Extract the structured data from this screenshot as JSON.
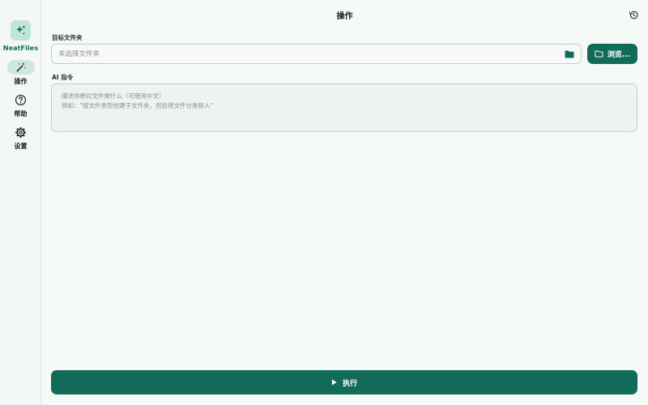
{
  "app": {
    "name": "NeatFiles",
    "logo_icon": "sparkles-icon",
    "accent": "#126a58"
  },
  "sidebar": {
    "items": [
      {
        "label": "操作",
        "icon": "magic-wand-icon",
        "active": true
      },
      {
        "label": "帮助",
        "icon": "help-circle-icon",
        "active": false
      },
      {
        "label": "设置",
        "icon": "gear-icon",
        "active": false
      }
    ]
  },
  "header": {
    "title": "操作",
    "history_icon": "history-icon"
  },
  "target_folder": {
    "label": "目标文件夹",
    "value": "",
    "placeholder": "未选择文件夹",
    "browse_label": "浏览..."
  },
  "ai_prompt": {
    "label": "AI 指令",
    "value": "",
    "placeholder": "描述你想对文件做什么（可使用中文）\n例如：\"按文件类型创建子文件夹，然后将文件分类移入\""
  },
  "run_button": {
    "label": "执行",
    "icon": "play-icon"
  }
}
